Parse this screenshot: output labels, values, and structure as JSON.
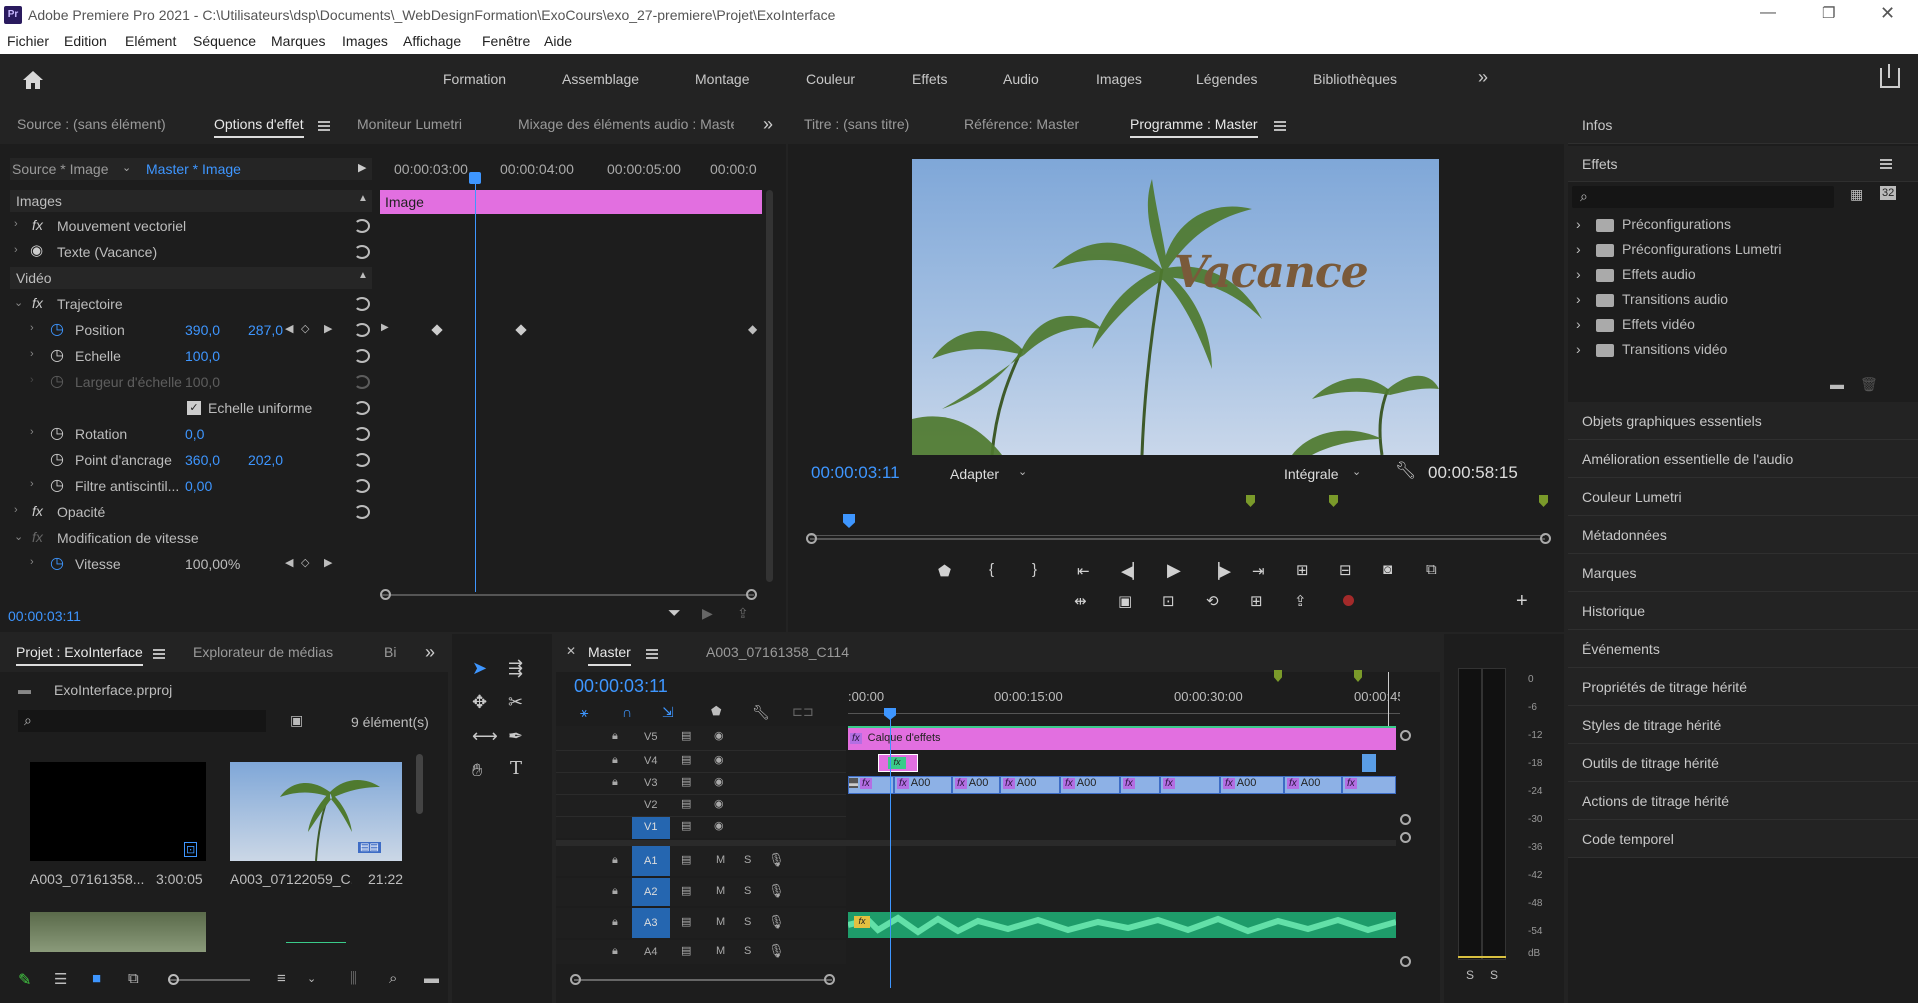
{
  "title_bar": {
    "app_icon": "Pr",
    "title": "Adobe Premiere Pro 2021 - C:\\Utilisateurs\\dsp\\Documents\\_WebDesignFormation\\ExoCours\\exo_27-premiere\\Projet\\ExoInterface"
  },
  "menu": [
    "Fichier",
    "Edition",
    "Elément",
    "Séquence",
    "Marques",
    "Images",
    "Affichage",
    "Fenêtre",
    "Aide"
  ],
  "workspaces": [
    "Formation",
    "Assemblage",
    "Montage",
    "Couleur",
    "Effets",
    "Audio",
    "Images",
    "Légendes",
    "Bibliothèques"
  ],
  "effect_controls": {
    "tabs": [
      "Source : (sans élément)",
      "Options d'effet",
      "Moniteur Lumetri",
      "Mixage des éléments audio : Maste"
    ],
    "source_label": "Source * Image",
    "master_label": "Master * Image",
    "timecodes": [
      "00:00:03:00",
      "00:00:04:00",
      "00:00:05:00",
      "00:00:0"
    ],
    "clip_name": "Image",
    "section_images": "Images",
    "section_video": "Vidéo",
    "rows": [
      {
        "label": "Mouvement vectoriel"
      },
      {
        "label": "Texte (Vacance)"
      },
      {
        "label": "Trajectoire"
      },
      {
        "label": "Position",
        "v1": "390,0",
        "v2": "287,0"
      },
      {
        "label": "Echelle",
        "v1": "100,0"
      },
      {
        "label": "Largeur d'échelle",
        "v1": "100,0"
      },
      {
        "label": "Echelle uniforme"
      },
      {
        "label": "Rotation",
        "v1": "0,0"
      },
      {
        "label": "Point d'ancrage",
        "v1": "360,0",
        "v2": "202,0"
      },
      {
        "label": "Filtre antiscintil...",
        "v1": "0,00"
      },
      {
        "label": "Opacité"
      },
      {
        "label": "Modification de vitesse"
      },
      {
        "label": "Vitesse",
        "v1": "100,00%"
      }
    ],
    "current_time": "00:00:03:11"
  },
  "program_monitor": {
    "tabs": [
      "Titre : (sans titre)",
      "Référence: Master",
      "Programme : Master"
    ],
    "overlay_text": "Vacance",
    "current_time": "00:00:03:11",
    "fit": "Adapter",
    "quality": "Intégrale",
    "duration": "00:00:58:15"
  },
  "project": {
    "tabs": [
      "Projet : ExoInterface",
      "Explorateur de médias",
      "Bi"
    ],
    "file": "ExoInterface.prproj",
    "count": "9 élément(s)",
    "items": [
      {
        "name": "A003_07161358...",
        "duration": "3:00:05"
      },
      {
        "name": "A003_07122059_C...",
        "duration": "21:22"
      }
    ]
  },
  "timeline": {
    "tabs": [
      "Master",
      "A003_07161358_C114"
    ],
    "current_time": "00:00:03:11",
    "ruler": [
      ":00:00",
      "00:00:15:00",
      "00:00:30:00",
      "00:00:45"
    ],
    "video_tracks": [
      "V5",
      "V4",
      "V3",
      "V2",
      "V1"
    ],
    "audio_tracks": [
      "A1",
      "A2",
      "A3",
      "A4"
    ],
    "calque": "Calque d'effets",
    "clip_label": "A00"
  },
  "vu_meter": {
    "scale": [
      "0",
      "-6",
      "-12",
      "-18",
      "-24",
      "-30",
      "-36",
      "-42",
      "-48",
      "-54",
      "dB"
    ],
    "solo": [
      "S",
      "S"
    ]
  },
  "right_panel": {
    "infos": "Infos",
    "effets": "Effets",
    "effets_tree": [
      "Préconfigurations",
      "Préconfigurations Lumetri",
      "Effets audio",
      "Transitions audio",
      "Effets vidéo",
      "Transitions vidéo"
    ],
    "items": [
      "Objets graphiques essentiels",
      "Amélioration essentielle de l'audio",
      "Couleur Lumetri",
      "Métadonnées",
      "Marques",
      "Historique",
      "Événements",
      "Propriétés de titrage hérité",
      "Styles de titrage hérité",
      "Outils de titrage hérité",
      "Actions de titrage hérité",
      "Code temporel"
    ]
  }
}
